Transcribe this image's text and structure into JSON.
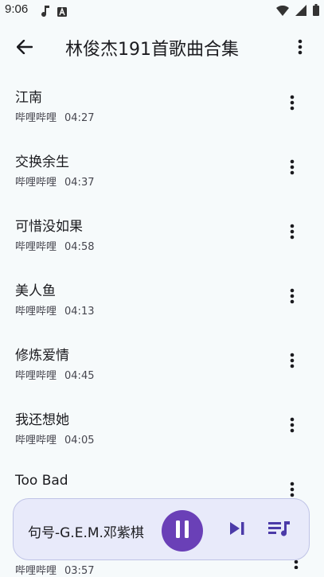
{
  "status_bar": {
    "time": "9:06",
    "left_icons": [
      "music-note-icon",
      "text-a-icon"
    ],
    "right_icons": [
      "wifi-icon",
      "signal-icon",
      "battery-icon"
    ]
  },
  "app_bar": {
    "back_icon": "arrow-left-icon",
    "title": "林俊杰191首歌曲合集",
    "more_icon": "more-vert-icon"
  },
  "songs": [
    {
      "title": "江南",
      "artist": "哔哩哔哩",
      "duration": "04:27"
    },
    {
      "title": "交换余生",
      "artist": "哔哩哔哩",
      "duration": "04:37"
    },
    {
      "title": "可惜没如果",
      "artist": "哔哩哔哩",
      "duration": "04:58"
    },
    {
      "title": "美人鱼",
      "artist": "哔哩哔哩",
      "duration": "04:13"
    },
    {
      "title": "修炼爱情",
      "artist": "哔哩哔哩",
      "duration": "04:45"
    },
    {
      "title": "我还想她",
      "artist": "哔哩哔哩",
      "duration": "04:05"
    },
    {
      "title": "Too Bad",
      "artist": "",
      "duration": ""
    }
  ],
  "peek_row": {
    "artist": "哔哩哔哩",
    "duration": "03:57"
  },
  "mini_player": {
    "now_playing": "句号-G.E.M.邓紫棋",
    "play_state_icon": "pause-icon",
    "next_icon": "skip-next-icon",
    "queue_icon": "queue-music-icon"
  },
  "colors": {
    "background": "#f6fafb",
    "player_bg": "#e8eafa",
    "accent": "#6a40b7",
    "icon": "#4b3aa8"
  }
}
